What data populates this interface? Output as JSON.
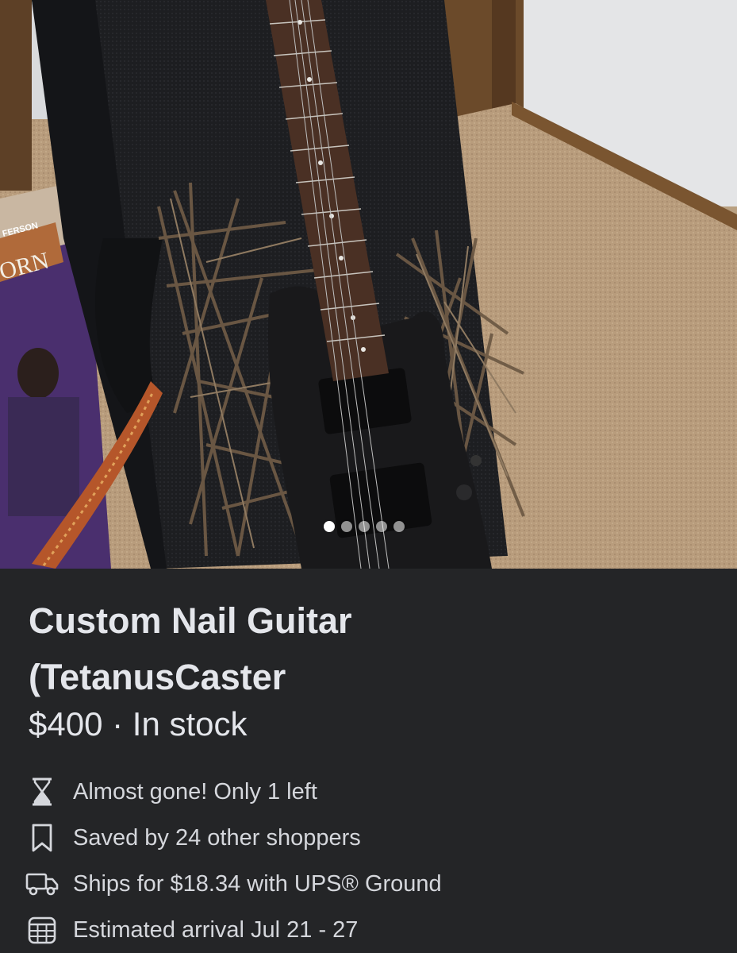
{
  "listing": {
    "title_line1": "Custom Nail Guitar",
    "title_line2": "(TetanusCaster",
    "price": "$400",
    "separator": "·",
    "stock_status": "In stock"
  },
  "carousel": {
    "photo_count": 5,
    "active_index": 0
  },
  "details": [
    {
      "icon": "hourglass-icon",
      "text": "Almost gone! Only 1 left"
    },
    {
      "icon": "bookmark-icon",
      "text": "Saved by 24 other shoppers"
    },
    {
      "icon": "delivery-truck-icon",
      "text": "Ships for $18.34 with UPS® Ground"
    },
    {
      "icon": "calendar-icon",
      "text": "Estimated arrival Jul 21 - 27"
    }
  ],
  "photo": {
    "record_sleeve_text_1": "FERSON",
    "record_sleeve_text_2": "ORN"
  },
  "colors": {
    "panel_background": "#242527",
    "primary_text": "#e4e6eb",
    "secondary_text": "#d5d7dc"
  }
}
